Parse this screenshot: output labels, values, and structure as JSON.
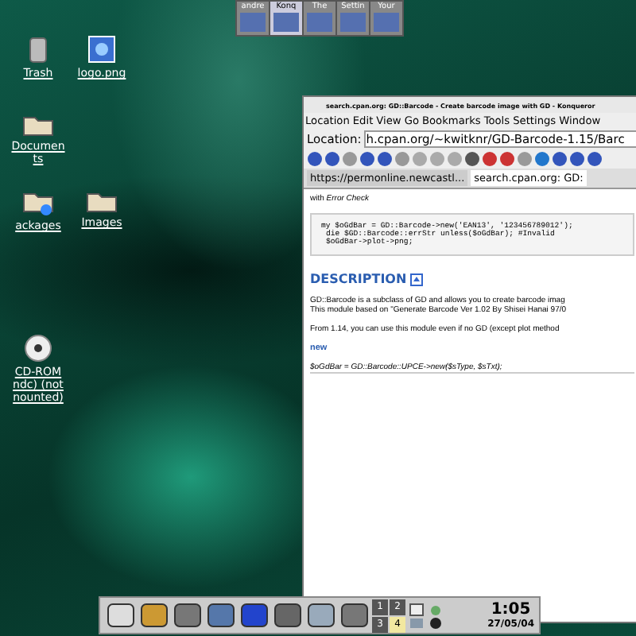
{
  "top_pager": [
    {
      "label": "andre",
      "selected": false
    },
    {
      "label": "Konq",
      "selected": true
    },
    {
      "label": "The",
      "selected": false
    },
    {
      "label": "Settin",
      "selected": false
    },
    {
      "label": "Your",
      "selected": false
    }
  ],
  "desktop_icons": [
    {
      "kind": "trash",
      "lines": [
        "Trash"
      ]
    },
    {
      "kind": "image",
      "lines": [
        "logo.png"
      ]
    },
    {
      "kind": "folder",
      "lines": [
        "Documen",
        "ts"
      ]
    },
    {
      "kind": "package",
      "lines": [
        "ackages"
      ]
    },
    {
      "kind": "folder",
      "lines": [
        "Images"
      ]
    },
    {
      "kind": "cdrom",
      "lines": [
        "CD-ROM",
        "ndc) (not",
        "nounted)"
      ]
    }
  ],
  "window": {
    "title": "search.cpan.org: GD::Barcode - Create barcode image with GD - Konqueror",
    "menu": [
      "Location",
      "Edit",
      "View",
      "Go",
      "Bookmarks",
      "Tools",
      "Settings",
      "Window"
    ],
    "location_label": "Location:",
    "url": "h.cpan.org/~kwitknr/GD-Barcode-1.15/Barc",
    "tabs": [
      {
        "label": "https://permonline.newcastl...",
        "selected": false
      },
      {
        "label": "search.cpan.org: GD:",
        "selected": true
      }
    ],
    "content": {
      "intro": "with *Error Check*",
      "code": [
        "my $oGdBar = GD::Barcode->new('EAN13', '123456789012');",
        "die $GD::Barcode::errStr unless($oGdBar);      #Invalid",
        "$oGdBar->plot->png;"
      ],
      "heading": "DESCRIPTION",
      "paragraphs": [
        [
          "GD::Barcode is a subclass of GD and allows you to create barcode imag",
          "This module based on \"Generate Barcode Ver 1.02 By Shisei Hanai 97/0"
        ],
        [
          "From 1.14, you can use this module even if no GD (except plot method"
        ]
      ],
      "method": "new",
      "code2": "$oGdBar = GD::Barcode::UPCE->new($sType, $sTxt);"
    }
  },
  "taskbar": {
    "desktops": [
      {
        "label": "1",
        "selected": false
      },
      {
        "label": "2",
        "selected": false
      },
      {
        "label": "3",
        "selected": false
      },
      {
        "label": "4",
        "selected": true
      }
    ],
    "time": "1:05",
    "date": "27/05/04"
  }
}
